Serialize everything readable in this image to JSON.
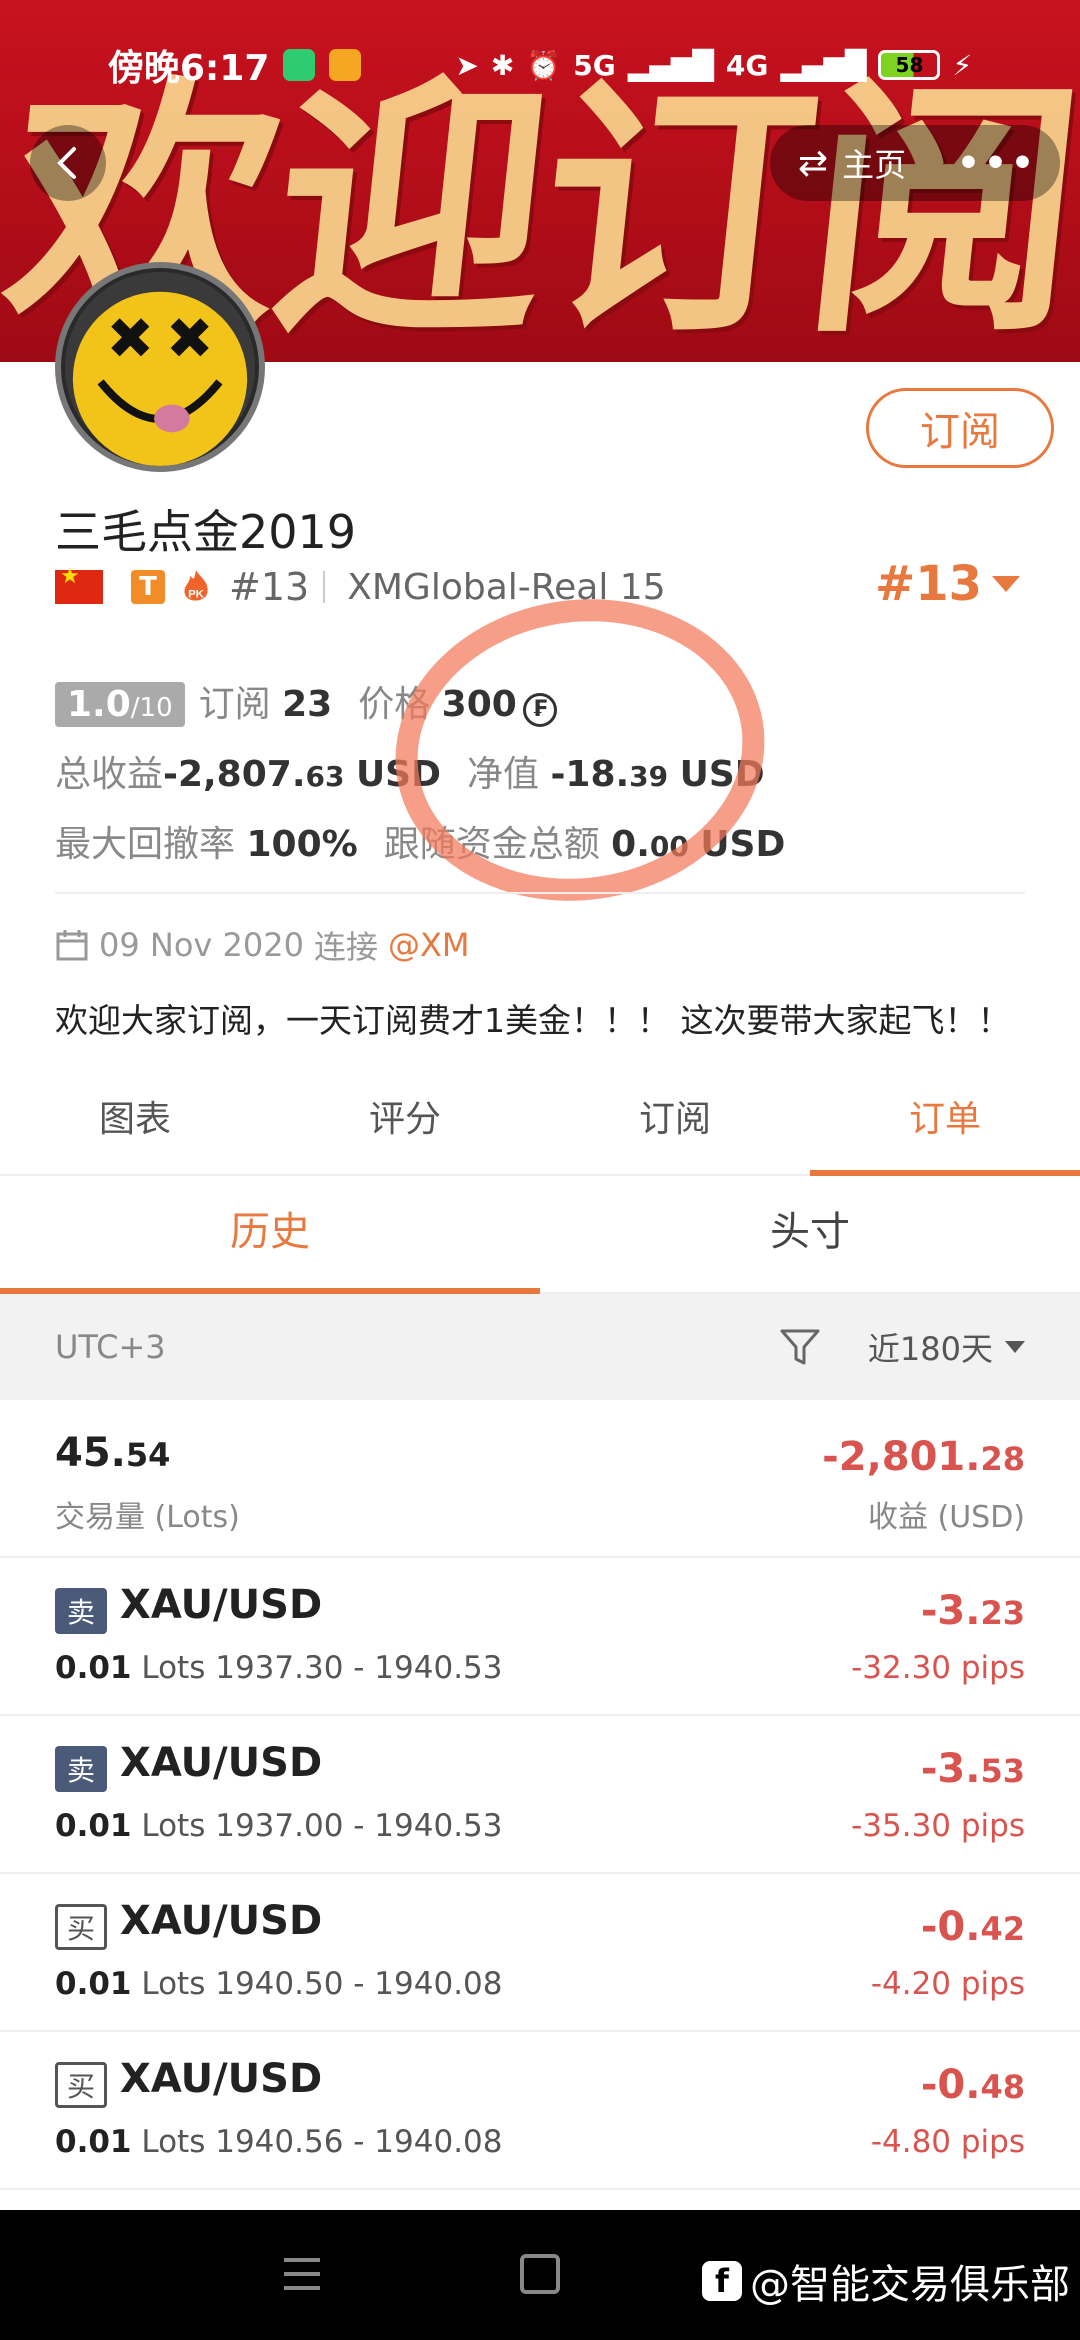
{
  "status_bar": {
    "time": "傍晚6:17",
    "network_1": "5G",
    "network_2": "4G",
    "battery": "58"
  },
  "banner": {
    "chars": [
      "欢",
      "迎",
      "订",
      "阅"
    ],
    "home_label": "主页"
  },
  "profile": {
    "subscribe_label": "订阅",
    "name": "三毛点金2019",
    "t_badge": "T",
    "pk_badge": "PK",
    "rank_small": "#13",
    "account": "XMGlobal-Real 15",
    "rank_big": "#13"
  },
  "stats": {
    "rating_main": "1.0",
    "rating_den": "/10",
    "subscribers_label": "订阅",
    "subscribers_value": "23",
    "price_label": "价格",
    "price_value": "300",
    "price_currency_symbol": "₣",
    "total_profit_label": "总收益",
    "total_profit_main": "-2,807.",
    "total_profit_dec": "63",
    "total_profit_unit": "USD",
    "equity_label": "净值",
    "equity_main": "-18.",
    "equity_dec": "39",
    "equity_unit": "USD",
    "drawdown_label": "最大回撤率",
    "drawdown_value": "100%",
    "follow_label": "跟随资金总额",
    "follow_main": "0.",
    "follow_dec": "00",
    "follow_unit": "USD"
  },
  "joined": {
    "date": "09 Nov 2020",
    "connect_label": "连接",
    "broker": "@XM"
  },
  "bio": "欢迎大家订阅，一天订阅费才1美金！！！ 这次要带大家起飞！！",
  "tabs": [
    {
      "label": "图表"
    },
    {
      "label": "评分"
    },
    {
      "label": "订阅"
    },
    {
      "label": "订单"
    }
  ],
  "subtabs": [
    {
      "label": "历史"
    },
    {
      "label": "头寸"
    }
  ],
  "filter": {
    "timezone": "UTC+3",
    "period": "近180天"
  },
  "summary": {
    "lots_main": "45.",
    "lots_dec": "54",
    "lots_label": "交易量 (Lots)",
    "profit_main": "-2,801.",
    "profit_dec": "28",
    "profit_label": "收益 (USD)"
  },
  "orders": [
    {
      "side": "卖",
      "side_type": "sell",
      "symbol": "XAU/USD",
      "lots": "0.01",
      "lots_unit": "Lots",
      "prices": "1937.30 - 1940.53",
      "pl_main": "-3.",
      "pl_dec": "23",
      "pips": "-32.30 pips"
    },
    {
      "side": "卖",
      "side_type": "sell",
      "symbol": "XAU/USD",
      "lots": "0.01",
      "lots_unit": "Lots",
      "prices": "1937.00 - 1940.53",
      "pl_main": "-3.",
      "pl_dec": "53",
      "pips": "-35.30 pips"
    },
    {
      "side": "买",
      "side_type": "buy",
      "symbol": "XAU/USD",
      "lots": "0.01",
      "lots_unit": "Lots",
      "prices": "1940.50 - 1940.08",
      "pl_main": "-0.",
      "pl_dec": "42",
      "pips": "-4.20 pips"
    },
    {
      "side": "买",
      "side_type": "buy",
      "symbol": "XAU/USD",
      "lots": "0.01",
      "lots_unit": "Lots",
      "prices": "1940.56 - 1940.08",
      "pl_main": "-0.",
      "pl_dec": "48",
      "pips": "-4.80 pips"
    }
  ],
  "watermark": {
    "fb_glyph": "f",
    "text": "@智能交易俱乐部"
  },
  "colors": {
    "accent": "#e8793e",
    "loss": "#d9534f",
    "banner_red": "#c8121f"
  }
}
